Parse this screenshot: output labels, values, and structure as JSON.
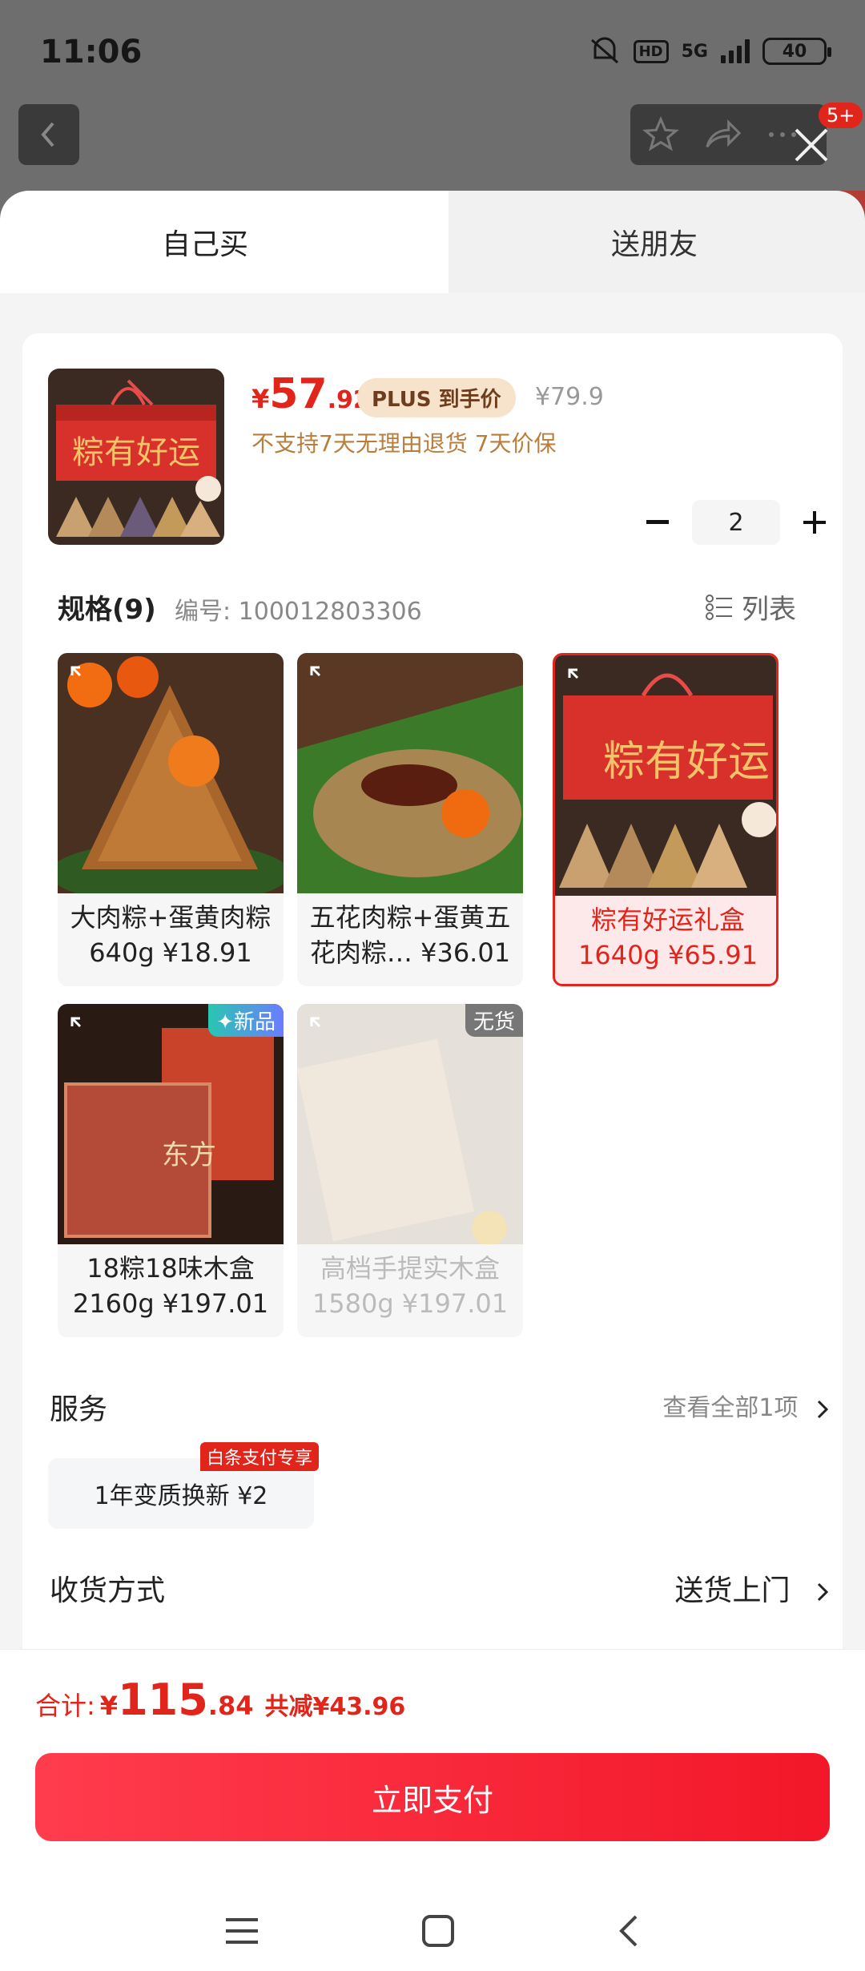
{
  "status_bar": {
    "time": "11:06",
    "network": "5G",
    "hd": "HD",
    "battery": "40"
  },
  "nav": {
    "message_count": "5+"
  },
  "tabs": {
    "self": "自己买",
    "friend": "送朋友"
  },
  "product": {
    "price_currency": "¥",
    "price_int": "57",
    "price_dec": ".92",
    "plus_badge": "PLUS 到手价",
    "original_price": "¥79.9",
    "policy": "不支持7天无理由退货  7天价保",
    "quantity": "2"
  },
  "spec": {
    "title": "规格(9)",
    "code": "编号: 100012803306",
    "list_label": "列表",
    "items": [
      {
        "line1": "大肉粽+蛋黄肉粽",
        "line2": "640g ¥18.91",
        "tag": ""
      },
      {
        "line1": "五花肉粽+蛋黄五",
        "line2": "花肉粽… ¥36.01",
        "tag": ""
      },
      {
        "line1": "粽有好运礼盒",
        "line2": "1640g ¥65.91",
        "tag": ""
      },
      {
        "line1": "18粽18味木盒",
        "line2": "2160g ¥197.01",
        "tag": "✦新品"
      },
      {
        "line1": "高档手提实木盒",
        "line2": "1580g ¥197.01",
        "tag": "无货"
      }
    ]
  },
  "service": {
    "title": "服务",
    "view_all": "查看全部1项",
    "chip": "1年变质换新  ¥2",
    "chip_badge": "白条支付专享"
  },
  "shipping": {
    "title": "收货方式",
    "value": "送货上门"
  },
  "footer": {
    "total_label": "合计:",
    "total_currency": "¥",
    "total_int": "115",
    "total_dec": ".84",
    "total_save": "共减¥43.96",
    "pay_button": "立即支付"
  },
  "colors": {
    "accent": "#e1251b",
    "plus_bg": "#f7e2cc",
    "policy": "#b97d3c"
  },
  "icons": [
    "back-icon",
    "star-icon",
    "share-icon",
    "more-icon",
    "close-icon",
    "list-icon",
    "chevron-right-icon",
    "menu-icon",
    "home-icon",
    "back-nav-icon"
  ]
}
